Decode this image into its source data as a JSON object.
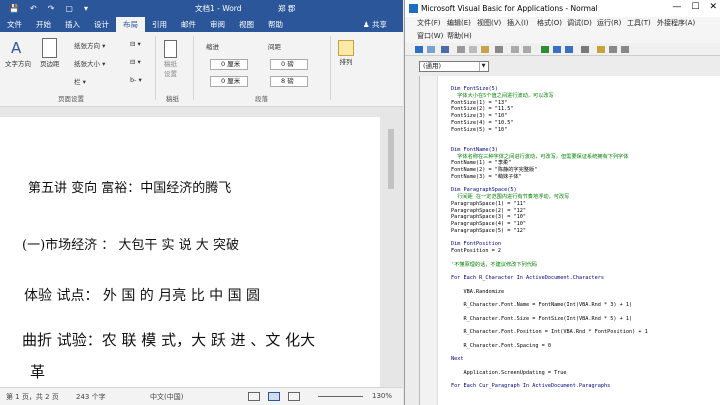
{
  "word": {
    "quick_access": [
      "💾",
      "↶",
      "↷",
      "▢",
      "▾"
    ],
    "doc_title": "文档1 - Word",
    "user": "郑 郡",
    "tabs": [
      "文件",
      "开始",
      "插入",
      "设计",
      "布局",
      "引用",
      "邮件",
      "审阅",
      "视图",
      "帮助"
    ],
    "active_tab": "布局",
    "share": "♟ 共享",
    "ribbon": {
      "text_direction": "文字方向",
      "margins": "页边距",
      "orientation": "纸张方向 ▾",
      "size": "纸张大小 ▾",
      "columns": "栏 ▾",
      "breaks": "⊟ ▾",
      "line_numbers": "⊟ ▾",
      "hyphenation": "b- ▾",
      "page_setup_label": "页面设置",
      "draft": "稿纸\n设置",
      "draft_label": "稿纸",
      "indent_label": "缩进",
      "spacing_label": "间距",
      "left_indent": "0 厘米",
      "right_indent": "0 厘米",
      "before": "0 磅",
      "after": "8 磅",
      "paragraph_label": "段落",
      "arrange": "排列"
    },
    "lines": [
      "第五讲  变向  富裕：中国经济的腾飞",
      "(一)市场经济 ：  大包干  实  说 大  突破",
      "体验  试点：  外  国  的  月亮  比  中  国  圆",
      "曲折  试验：农  联  模  式，大  跃  进 、文  化大",
      "革"
    ],
    "status": {
      "page": "第 1 页，共 2 页",
      "words": "243 个字",
      "lang": "中文(中国)",
      "zoom": "130%"
    }
  },
  "vba": {
    "title": "Microsoft Visual Basic for Applications - Normal",
    "window_controls": [
      "—",
      "☐",
      "✕"
    ],
    "menu_row1": [
      "文件(F)",
      "编辑(E)",
      "视图(V)",
      "插入(I)",
      "格式(O)",
      "调试(D)",
      "运行(R)",
      "工具(T)",
      "外接程序(A)"
    ],
    "menu_row2": [
      "窗口(W)",
      "帮助(H)"
    ],
    "combo": "(通用)",
    "code": [
      {
        "t": "Dim FontSize(5)",
        "s": "k"
      },
      {
        "t": "  字体大小在5个值之间进行波动，可以改写",
        "s": "c"
      },
      {
        "t": "FontSize(1) = \"13\"",
        "s": "n"
      },
      {
        "t": "FontSize(2) = \"11.5\"",
        "s": "n"
      },
      {
        "t": "FontSize(3) = \"10\"",
        "s": "n"
      },
      {
        "t": "FontSize(4) = \"10.5\"",
        "s": "n"
      },
      {
        "t": "FontSize(5) = \"10\"",
        "s": "n"
      },
      {
        "t": "",
        "s": "n"
      },
      {
        "t": "",
        "s": "n"
      },
      {
        "t": "Dim FontName(3)",
        "s": "k"
      },
      {
        "t": "  字体名称在三种字体之间进行波动，可改写，但需要保证系统拥有下列字体",
        "s": "c"
      },
      {
        "t": "FontName(1) = \"李柔\"",
        "s": "n"
      },
      {
        "t": "FontName(2) = \"陈静的字完整版\"",
        "s": "n"
      },
      {
        "t": "FontName(3) = \"萌妹子体\"",
        "s": "n"
      },
      {
        "t": "",
        "s": "n"
      },
      {
        "t": "Dim ParagraphSpace(5)",
        "s": "k"
      },
      {
        "t": "  行间距 在一定范围内进行有节奏地浮动，可改写",
        "s": "c"
      },
      {
        "t": "ParagraphSpace(1) = \"11\"",
        "s": "n"
      },
      {
        "t": "ParagraphSpace(2) = \"12\"",
        "s": "n"
      },
      {
        "t": "ParagraphSpace(3) = \"10\"",
        "s": "n"
      },
      {
        "t": "ParagraphSpace(4) = \"10\"",
        "s": "n"
      },
      {
        "t": "ParagraphSpace(5) = \"12\"",
        "s": "n"
      },
      {
        "t": "",
        "s": "n"
      },
      {
        "t": "Dim FontPosition",
        "s": "k"
      },
      {
        "t": "FontPosition = 2",
        "s": "n"
      },
      {
        "t": "",
        "s": "n"
      },
      {
        "t": "'不懂原理的话，不建议修改下列代码",
        "s": "c"
      },
      {
        "t": "",
        "s": "n"
      },
      {
        "t": "For Each R_Character In ActiveDocument.Characters",
        "s": "k"
      },
      {
        "t": "",
        "s": "n"
      },
      {
        "t": "    VBA.Randomize",
        "s": "n"
      },
      {
        "t": "",
        "s": "n"
      },
      {
        "t": "    R_Character.Font.Name = FontName(Int(VBA.Rnd * 3) + 1)",
        "s": "n"
      },
      {
        "t": "",
        "s": "n"
      },
      {
        "t": "    R_Character.Font.Size = FontSize(Int(VBA.Rnd * 5) + 1)",
        "s": "n"
      },
      {
        "t": "",
        "s": "n"
      },
      {
        "t": "    R_Character.Font.Position = Int(VBA.Rnd * FontPosition) + 1",
        "s": "n"
      },
      {
        "t": "",
        "s": "n"
      },
      {
        "t": "    R_Character.Font.Spacing = 0",
        "s": "n"
      },
      {
        "t": "",
        "s": "n"
      },
      {
        "t": "Next",
        "s": "k"
      },
      {
        "t": "",
        "s": "n"
      },
      {
        "t": "    Application.ScreenUpdating = True",
        "s": "n"
      },
      {
        "t": "",
        "s": "n"
      },
      {
        "t": "For Each Cur_Paragraph In ActiveDocument.Paragraphs",
        "s": "k"
      }
    ]
  }
}
